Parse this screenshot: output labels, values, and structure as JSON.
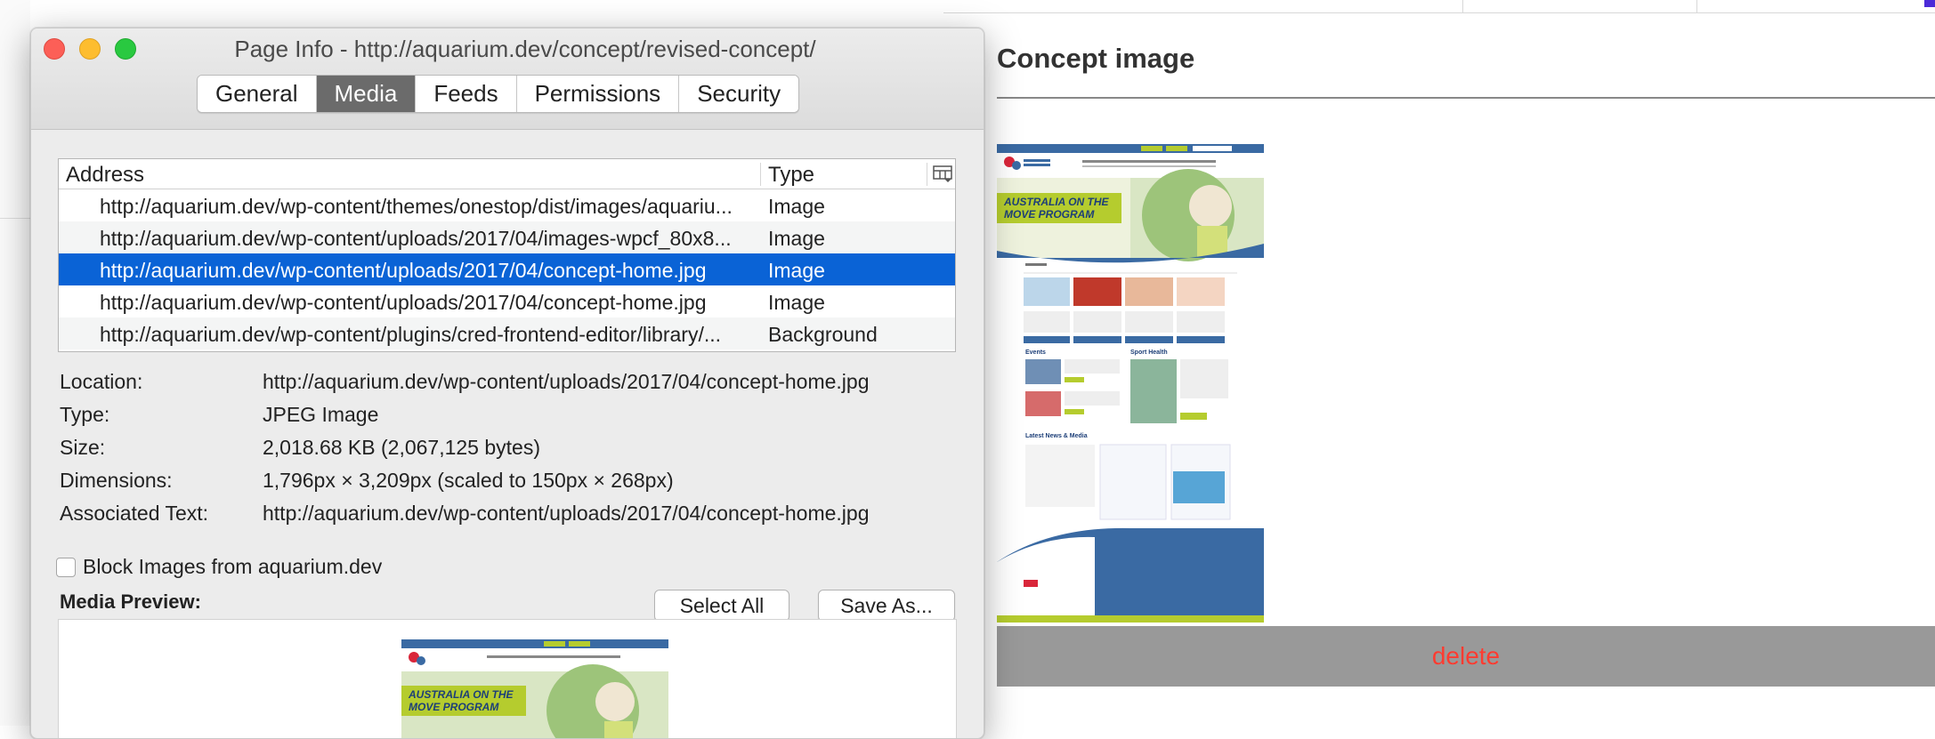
{
  "background_page": {
    "section_title": "Concept image",
    "delete_label": "delete",
    "delete_color": "#ff3b30"
  },
  "dialog": {
    "title": "Page Info - http://aquarium.dev/concept/revised-concept/",
    "tabs": [
      {
        "label": "General",
        "active": false
      },
      {
        "label": "Media",
        "active": true
      },
      {
        "label": "Feeds",
        "active": false
      },
      {
        "label": "Permissions",
        "active": false
      },
      {
        "label": "Security",
        "active": false
      }
    ],
    "table": {
      "headers": {
        "address": "Address",
        "type": "Type"
      },
      "rows": [
        {
          "address": "http://aquarium.dev/wp-content/themes/onestop/dist/images/aquariu...",
          "type": "Image"
        },
        {
          "address": "http://aquarium.dev/wp-content/uploads/2017/04/images-wpcf_80x8...",
          "type": "Image"
        },
        {
          "address": "http://aquarium.dev/wp-content/uploads/2017/04/concept-home.jpg",
          "type": "Image",
          "selected": true
        },
        {
          "address": "http://aquarium.dev/wp-content/uploads/2017/04/concept-home.jpg",
          "type": "Image"
        },
        {
          "address": "http://aquarium.dev/wp-content/plugins/cred-frontend-editor/library/...",
          "type": "Background"
        }
      ]
    },
    "details": {
      "location": {
        "label": "Location:",
        "value": "http://aquarium.dev/wp-content/uploads/2017/04/concept-home.jpg"
      },
      "type": {
        "label": "Type:",
        "value": "JPEG Image"
      },
      "size": {
        "label": "Size:",
        "value": "2,018.68 KB (2,067,125 bytes)"
      },
      "dimensions": {
        "label": "Dimensions:",
        "value": "1,796px × 3,209px (scaled to 150px × 268px)"
      },
      "associated_text": {
        "label": "Associated Text:",
        "value": "http://aquarium.dev/wp-content/uploads/2017/04/concept-home.jpg"
      }
    },
    "block_images_label": "Block Images from aquarium.dev",
    "block_images_checked": false,
    "select_all_label": "Select All",
    "save_as_label": "Save As...",
    "media_preview_label": "Media Preview:"
  },
  "thumbnail": {
    "banner_line1": "AUSTRALIA ON THE",
    "banner_line2": "MOVE PROGRAM",
    "events_label": "Events",
    "sport_health_label": "Sport Health",
    "news_label": "Latest News & Media",
    "brand_blue": "#3a6aa3",
    "brand_green": "#b5cc2e"
  }
}
